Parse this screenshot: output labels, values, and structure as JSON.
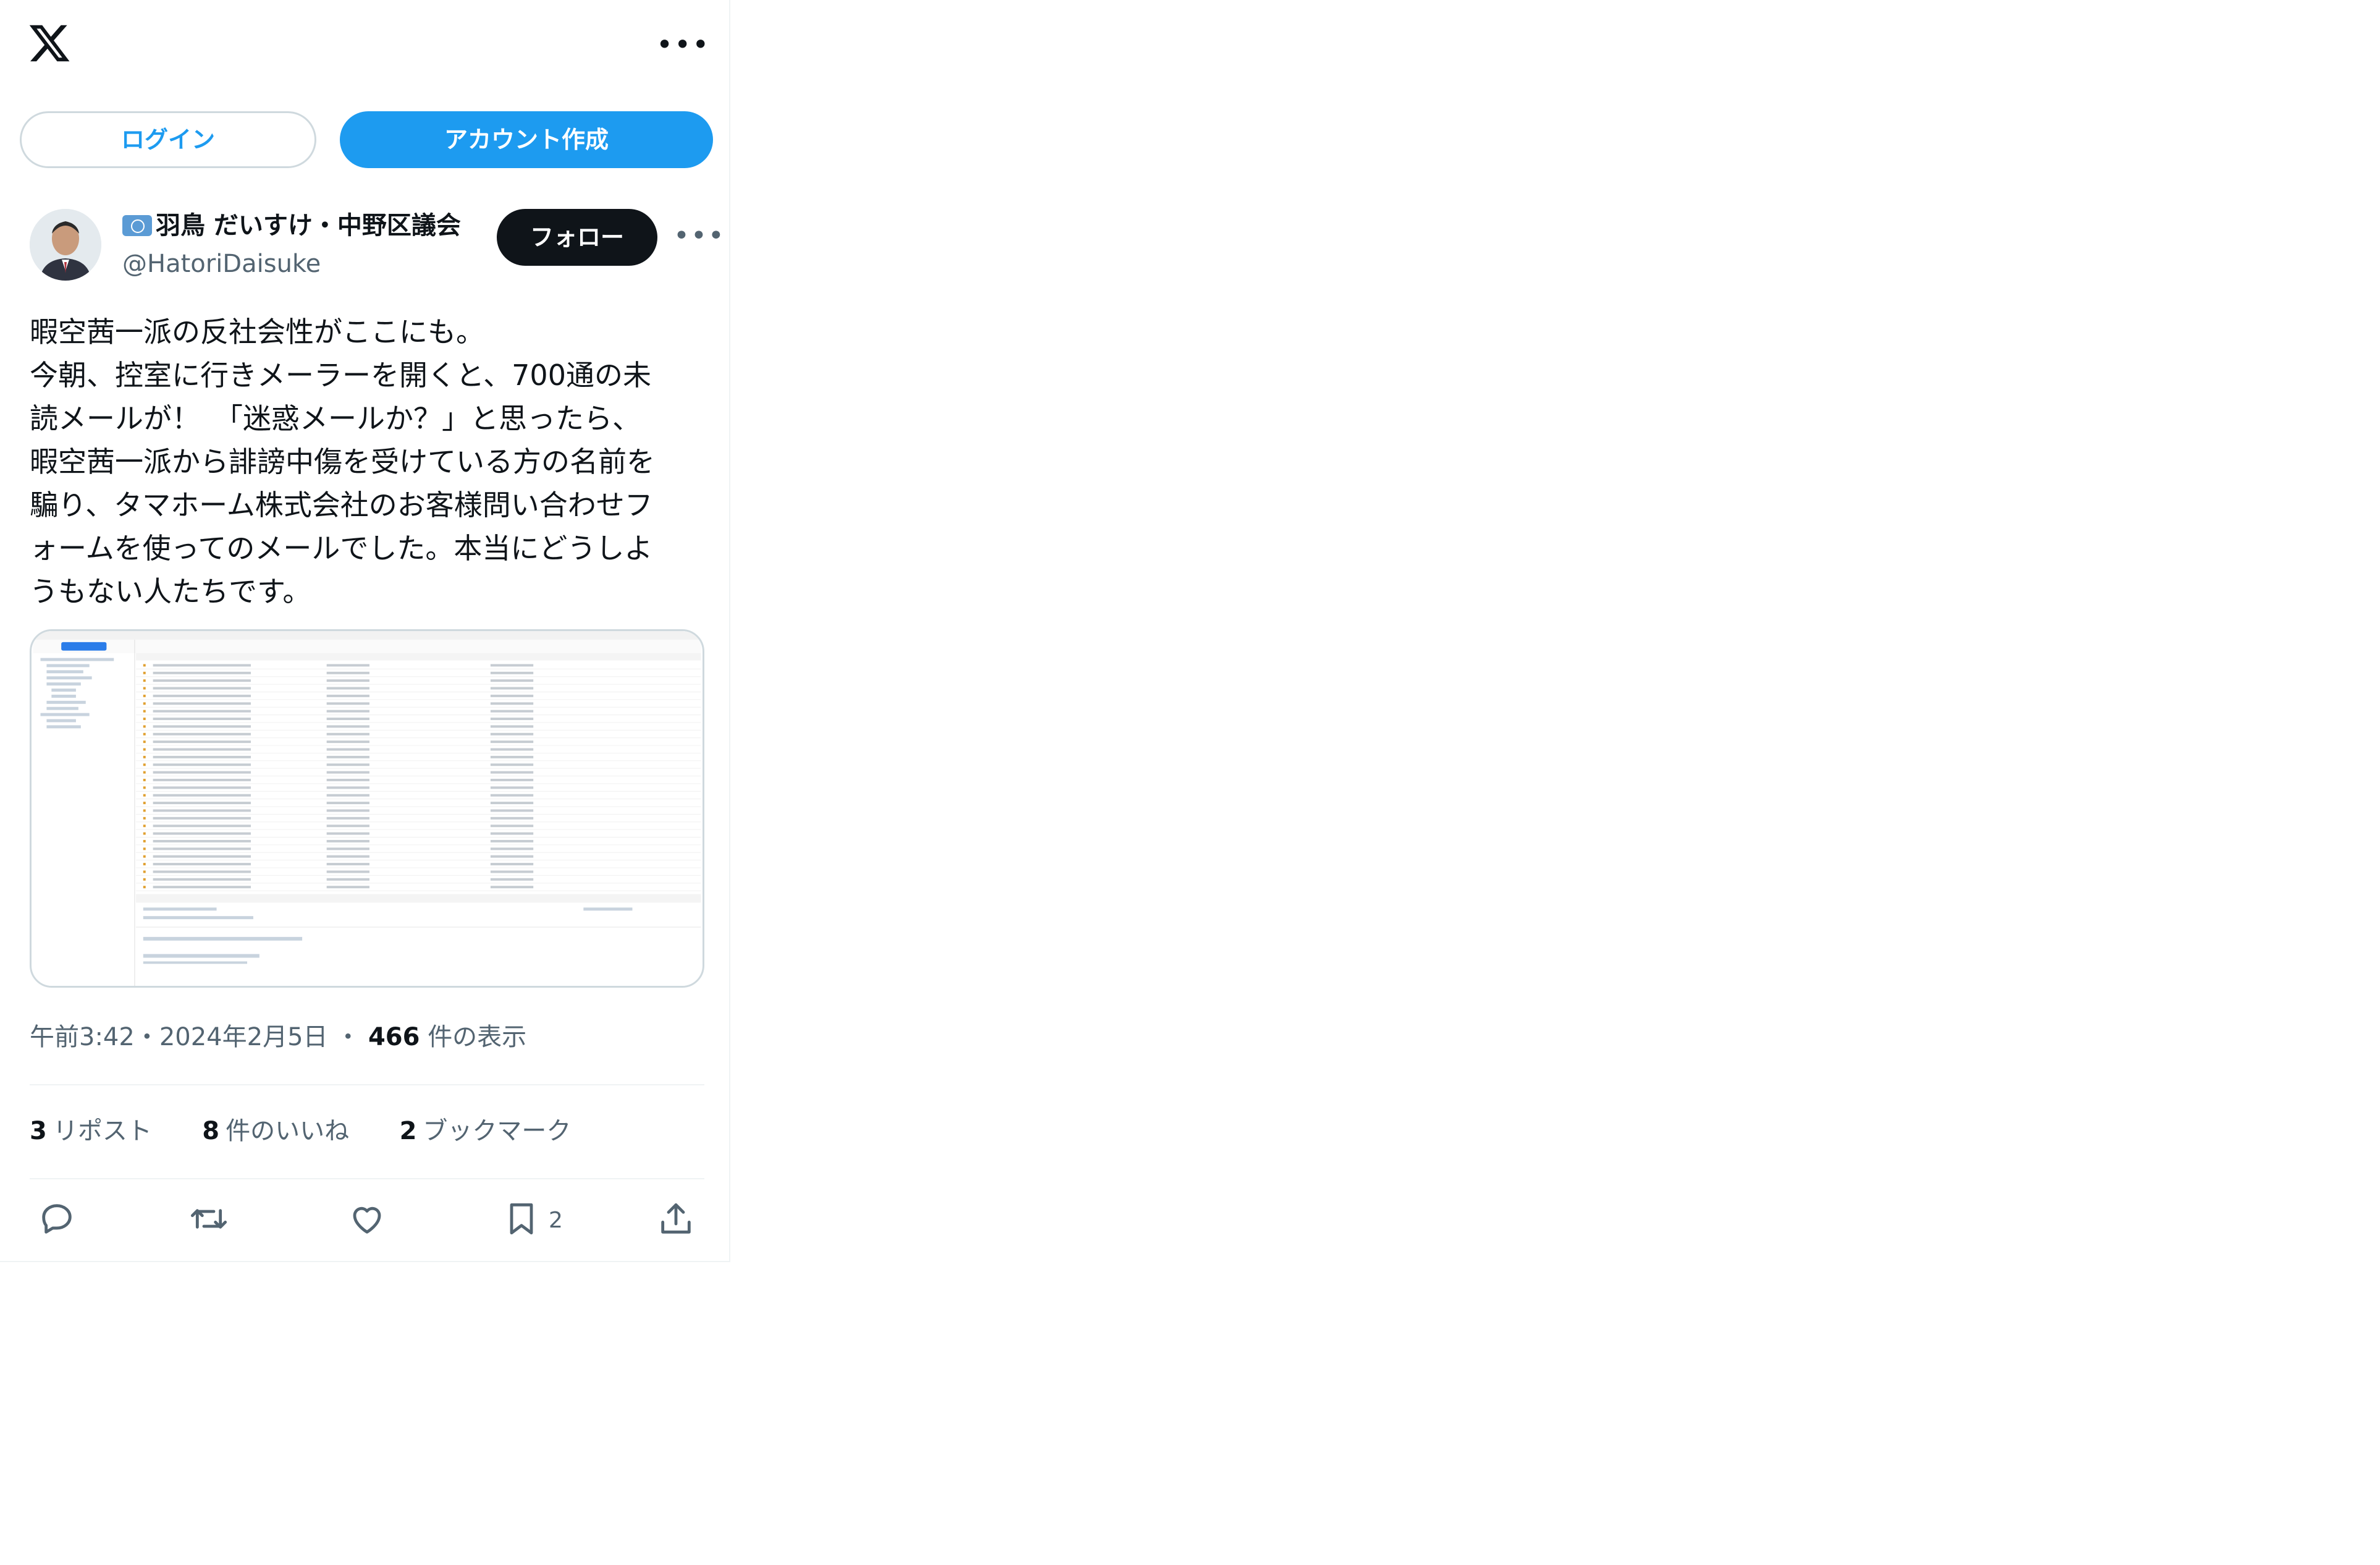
{
  "header": {
    "more_label": "•••"
  },
  "auth": {
    "login_label": "ログイン",
    "create_label": "アカウント作成"
  },
  "author": {
    "display_name": "羽鳥 だいすけ・中野区議会",
    "handle": "@HatoriDaisuke",
    "follow_label": "フォロー"
  },
  "tweet": {
    "text": "暇空茜一派の反社会性がここにも。\n今朝、控室に行きメーラーを開くと、700通の未\n読メールが！　「迷惑メールか？」と思ったら、\n暇空茜一派から誹謗中傷を受けている方の名前を\n騙り、タマホーム株式会社のお客様問い合わせフ\nォームを使ってのメールでした。本当にどうしよ\nうもない人たちです。",
    "time": "午前3:42",
    "date": "2024年2月5日",
    "sep": "・",
    "views": "466",
    "views_label": "件の表示"
  },
  "stats": {
    "reposts": "3",
    "reposts_label": "リポスト",
    "likes": "8",
    "likes_label": "件のいいね",
    "bookmarks": "2",
    "bookmarks_label": "ブックマーク"
  },
  "actions": {
    "icons": [
      "reply-icon",
      "repost-icon",
      "like-icon",
      "bookmark-icon",
      "share-icon"
    ],
    "bookmark_count": "2"
  },
  "colors": {
    "accent": "#1d9bf0",
    "text": "#0f1419",
    "muted": "#536471",
    "border": "#cfd9de"
  }
}
